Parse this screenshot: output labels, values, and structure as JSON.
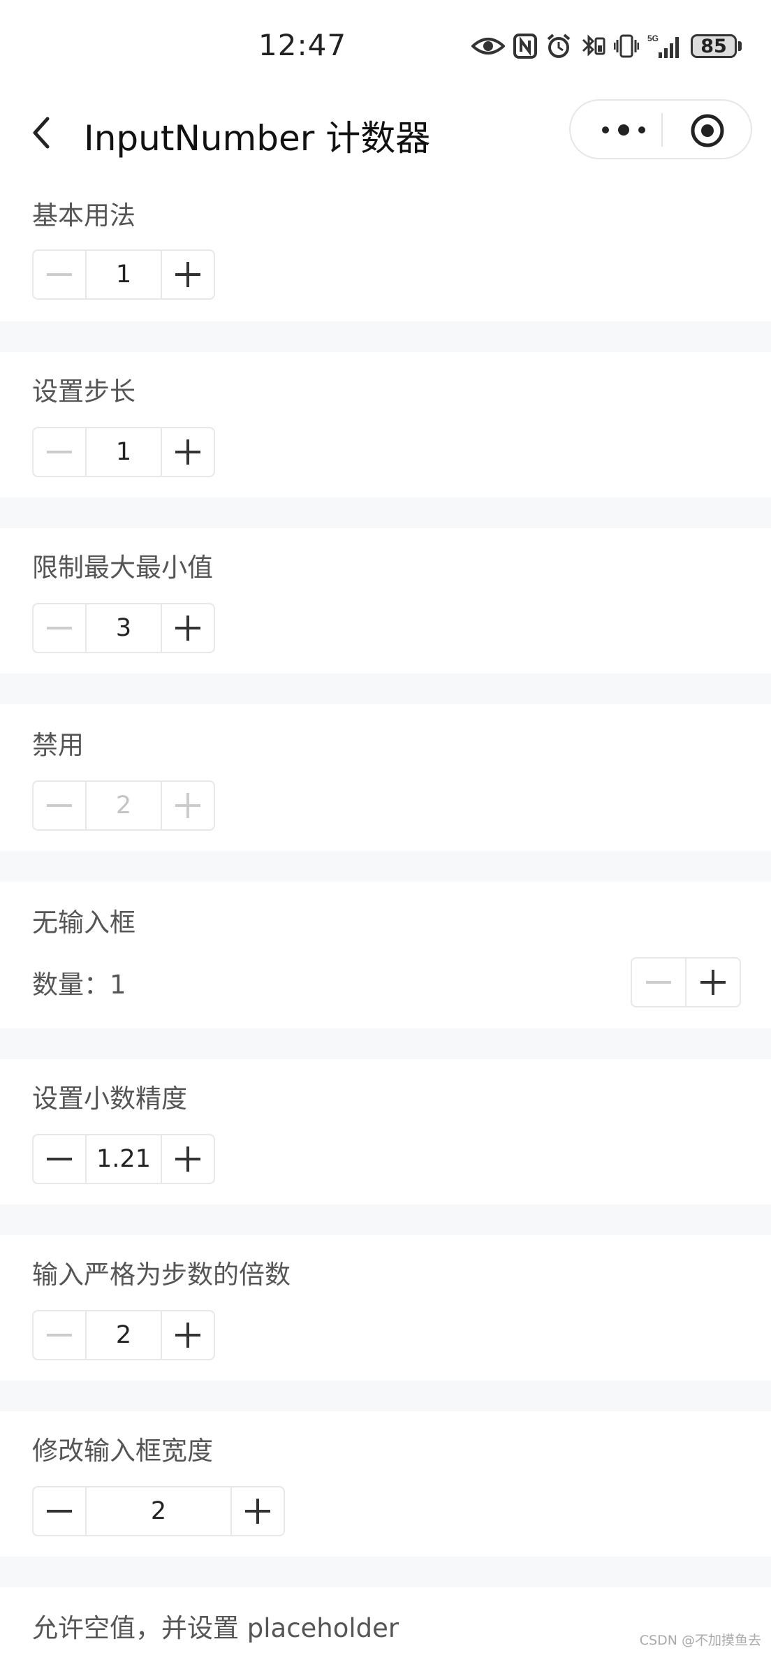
{
  "status": {
    "time": "12:47",
    "battery": "85",
    "network": "5G"
  },
  "nav": {
    "title": "InputNumber 计数器"
  },
  "sections": {
    "basic": {
      "title": "基本用法",
      "value": "1"
    },
    "step": {
      "title": "设置步长",
      "value": "1"
    },
    "limit": {
      "title": "限制最大最小值",
      "value": "3"
    },
    "disabled": {
      "title": "禁用",
      "value": "2"
    },
    "no_input": {
      "title": "无输入框",
      "qty_label": "数量：1"
    },
    "decimal": {
      "title": "设置小数精度",
      "value": "1.21"
    },
    "strict": {
      "title": "输入严格为步数的倍数",
      "value": "2"
    },
    "width": {
      "title": "修改输入框宽度",
      "value": "2"
    },
    "placeholder": {
      "title": "允许空值，并设置 placeholder"
    }
  },
  "watermark": "CSDN @不加摸鱼去",
  "colors": {
    "icon_active": "#333333",
    "icon_disabled": "#cccccc",
    "border": "#e8e8e8",
    "section_gap": "#f7f8fa"
  }
}
